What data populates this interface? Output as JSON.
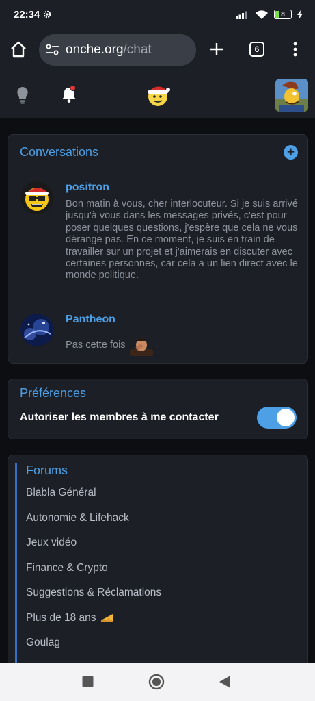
{
  "status_bar": {
    "time": "22:34",
    "battery": "8"
  },
  "browser": {
    "url_domain": "onche.org",
    "url_path": "/chat",
    "tab_count": "6"
  },
  "conversations": {
    "title": "Conversations",
    "items": [
      {
        "name": "positron",
        "message": "Bon matin à vous, cher interlocuteur. Si je suis arrivé jusqu'à vous dans les messages privés, c'est pour poser quelques questions, j'espère que cela ne vous dérange pas. En ce moment, je suis en train de travailler sur un projet et j'aimerais en discuter avec certaines personnes, car cela a un lien direct avec le monde politique."
      },
      {
        "name": "Pantheon",
        "message": "Pas cette fois"
      }
    ]
  },
  "preferences": {
    "title": "Préférences",
    "allow_contact_label": "Autoriser les membres à me contacter",
    "allow_contact_enabled": true
  },
  "forums": {
    "title": "Forums",
    "items": [
      "Blabla Général",
      "Autonomie & Lifehack",
      "Jeux vidéo",
      "Finance & Crypto",
      "Suggestions & Réclamations",
      "Plus de 18 ans",
      "Goulag"
    ]
  },
  "colors": {
    "accent": "#4d9fe6",
    "background": "#0d0e11",
    "card": "#1c1f26"
  }
}
